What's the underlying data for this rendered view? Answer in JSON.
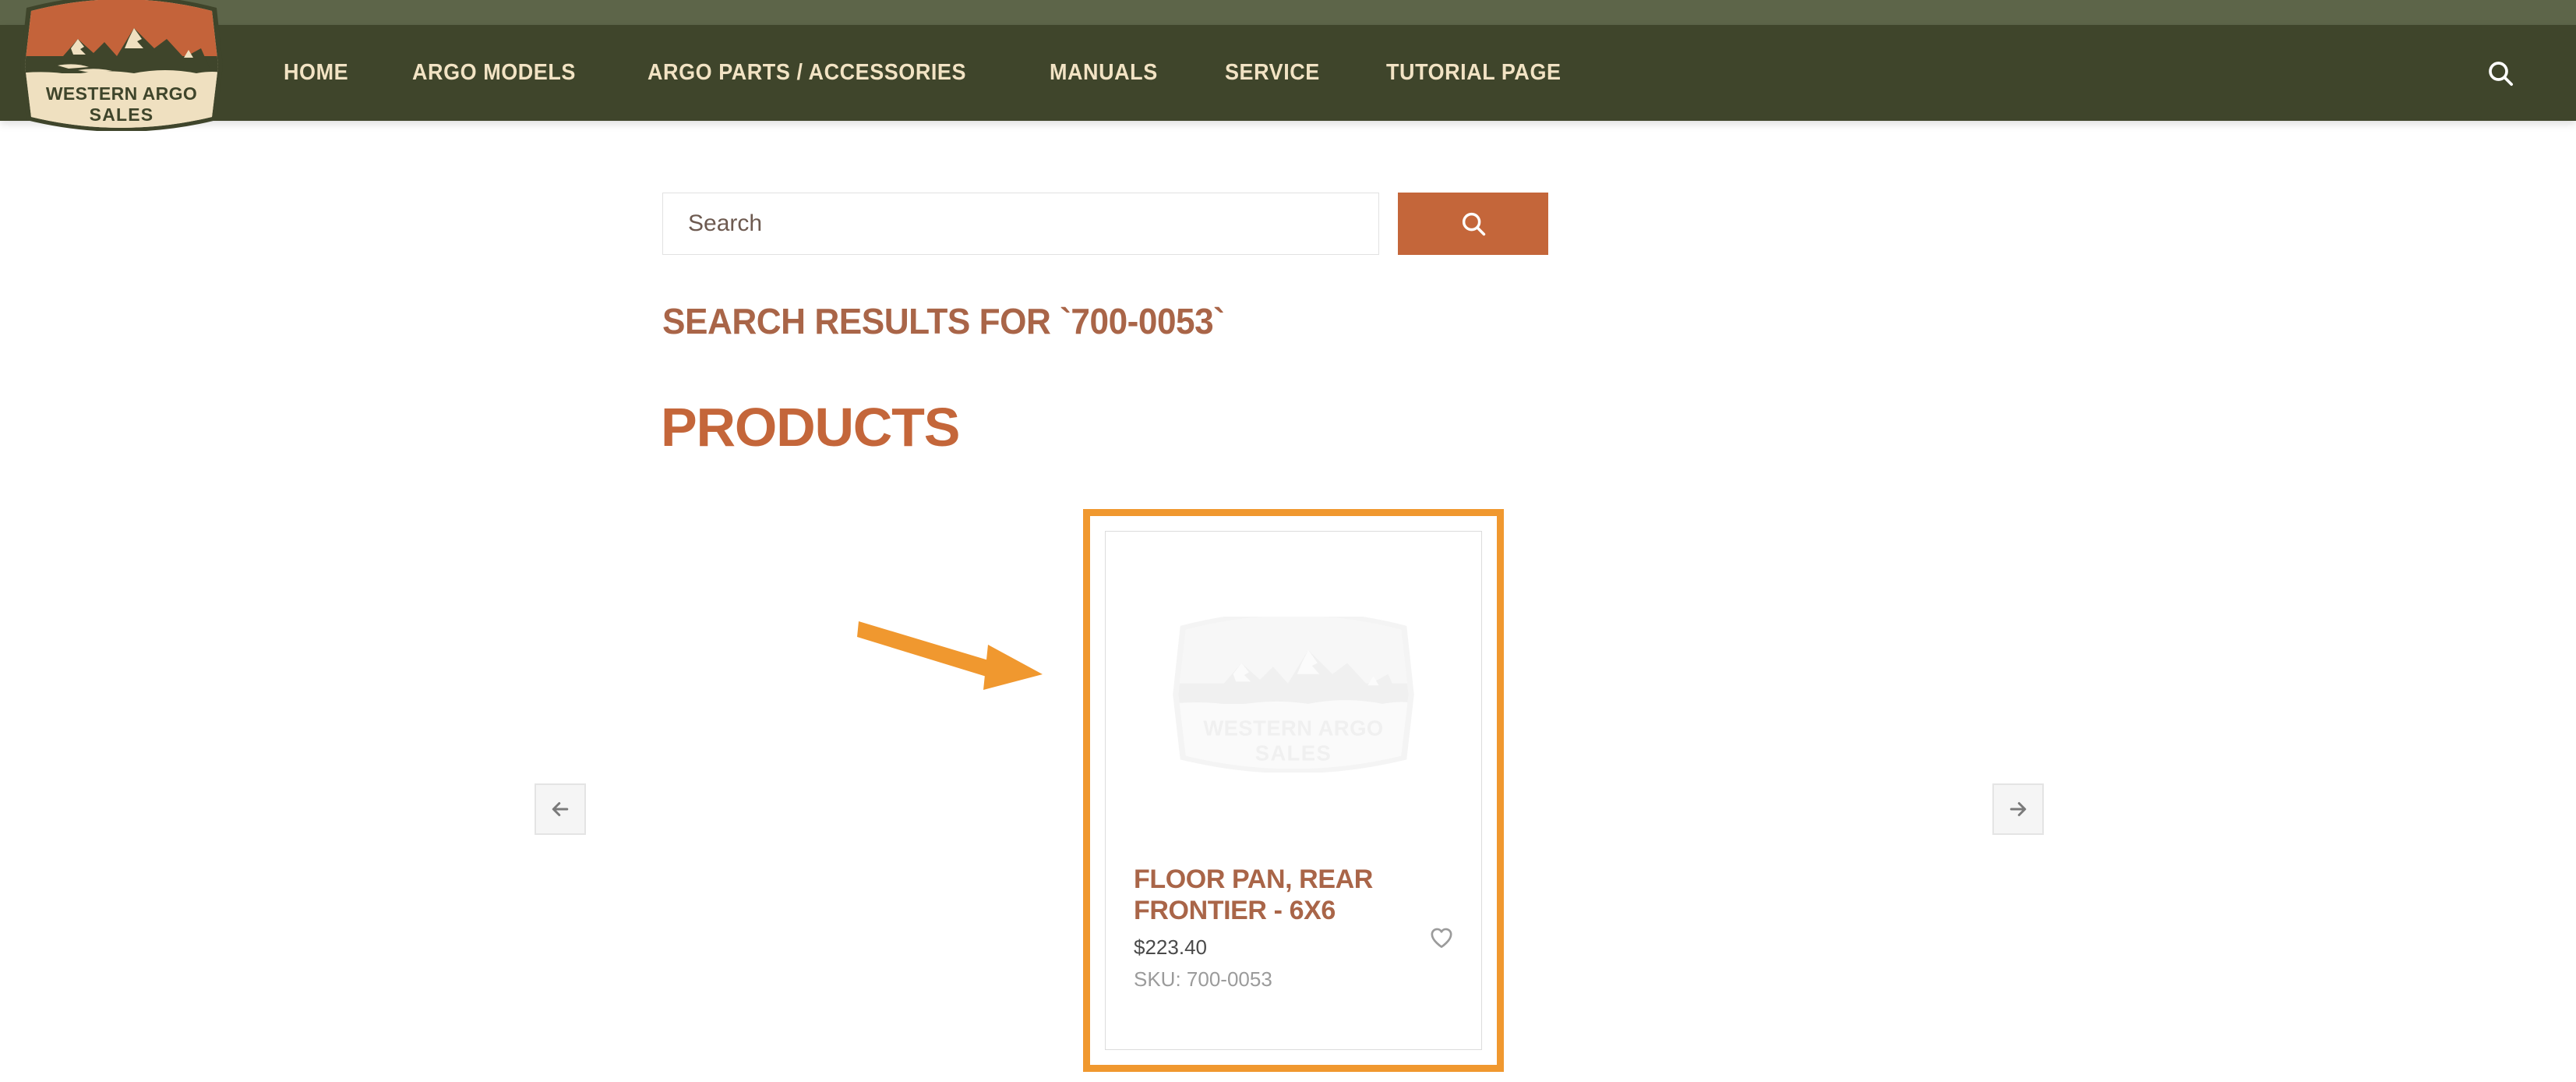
{
  "site": {
    "brand_name_line1": "WESTERN ARGO",
    "brand_name_line2": "SALES",
    "colors": {
      "header_dark": "#3F452B",
      "header_light_strip": "#5D6549",
      "accent_orange": "#C4663A",
      "highlight_orange": "#F0982F",
      "title_brown": "#A96548",
      "nav_text_cream": "#F2E3C4"
    }
  },
  "nav": {
    "items": [
      {
        "label": "HOME",
        "name": "nav-link-home"
      },
      {
        "label": "ARGO MODELS",
        "name": "nav-link-argo-models"
      },
      {
        "label": "ARGO PARTS / ACCESSORIES",
        "name": "nav-link-argo-parts-accessories"
      },
      {
        "label": "MANUALS",
        "name": "nav-link-manuals"
      },
      {
        "label": "SERVICE",
        "name": "nav-link-service"
      },
      {
        "label": "TUTORIAL PAGE",
        "name": "nav-link-tutorial-page"
      }
    ],
    "search_icon": "search-icon"
  },
  "search": {
    "placeholder": "Search",
    "value": "",
    "submit_icon": "search-icon"
  },
  "results": {
    "heading": "SEARCH RESULTS FOR `700-0053`",
    "section_heading": "PRODUCTS"
  },
  "carousel": {
    "prev_icon": "arrow-left-icon",
    "prev_label": "←",
    "next_icon": "arrow-right-icon",
    "next_label": "→"
  },
  "products": [
    {
      "title": "FLOOR PAN, REAR FRONTIER - 6X6",
      "price": "$223.40",
      "sku": "SKU: 700-0053",
      "image_placeholder": "western-argo-sales-logo-watermark",
      "wishlist_icon": "heart-outline-icon",
      "highlighted": true
    }
  ]
}
